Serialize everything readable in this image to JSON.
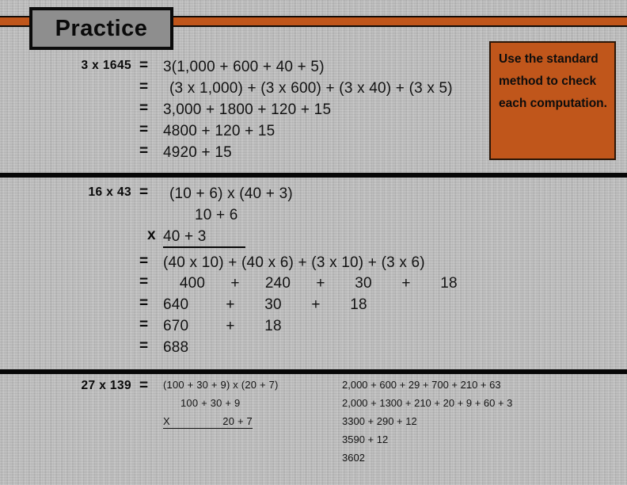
{
  "slide": {
    "title": "Practice",
    "background_color": "#bdbdbd",
    "accent_color": "#c0561b",
    "title_box_color": "#8e8e8e",
    "divider_color": "#070707"
  },
  "callout": {
    "text": "Use the standard method to check each computation.",
    "background_color": "#c0561b"
  },
  "problems": [
    {
      "label": "3 x 1645",
      "rows": [
        {
          "eq": "=",
          "expr": "3(1,000 + 600 + 40 + 5)"
        },
        {
          "eq": "=",
          "expr": "(3 x 1,000) + (3 x 600) + (3 x 40) + (3 x 5)"
        },
        {
          "eq": "=",
          "expr": "3,000 + 1800 + 120 + 15"
        },
        {
          "eq": "=",
          "expr": "4800 + 120 + 15"
        },
        {
          "eq": "=",
          "expr": "4920 + 15"
        }
      ]
    },
    {
      "label": "16 x 43",
      "rows": [
        {
          "eq": "=",
          "expr": "(10 + 6)  x  (40 + 3)"
        },
        {
          "eq": "",
          "expr": "10 + 6"
        },
        {
          "eq": "x",
          "expr": "40 + 3"
        },
        {
          "eq": "=",
          "expr": "(40 x 10) + (40 x 6) + (3 x 10) + (3 x 6)"
        },
        {
          "eq": "=",
          "terms": [
            "400",
            "+",
            "240",
            "+",
            "30",
            "+",
            "18"
          ]
        },
        {
          "eq": "=",
          "terms": [
            "640",
            "+",
            "30",
            "+",
            "18"
          ]
        },
        {
          "eq": "=",
          "terms": [
            "670",
            "+",
            "18"
          ]
        },
        {
          "eq": "=",
          "terms": [
            "688"
          ]
        }
      ]
    },
    {
      "label": "27 x 139",
      "rows": [
        {
          "eq": "=",
          "expr": "(100 + 30 + 9) x (20 + 7)"
        },
        {
          "eq": "",
          "expr": "100 + 30 + 9"
        },
        {
          "eq": "X",
          "expr": "20 + 7"
        }
      ],
      "right_column": [
        "2,000 + 600 + 29 + 700 + 210 + 63",
        "2,000 + 1300 + 210 + 20 + 9 + 60 + 3",
        "3300 + 290 + 12",
        "3590 + 12",
        "3602"
      ]
    }
  ]
}
